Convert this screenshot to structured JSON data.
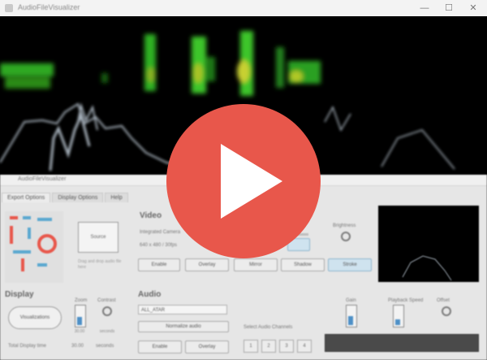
{
  "window": {
    "title": "AudioFileVisualizer",
    "controls": [
      "—",
      "☐",
      "✕"
    ]
  },
  "panel": {
    "title": "AudioFileVisualizer",
    "tabs": [
      "Export Options",
      "Display Options",
      "Help"
    ],
    "active_tab": 0,
    "preview": {
      "label": "Source",
      "hint": "Drag and drop audio file here"
    },
    "video": {
      "heading": "Video",
      "integrated_label": "Integrated Camera",
      "resolution": "640 x 480 / 30fps",
      "buttons": [
        "Enable",
        "Overlay",
        "Mirror",
        "Shadow",
        "Stroke"
      ],
      "active_buttons": [
        false,
        false,
        false,
        false,
        true
      ],
      "knob_label": "Brightness",
      "slider_fill": 0.7
    },
    "display": {
      "heading": "Display",
      "pill_label": "Visualizations",
      "knob1_label": "Zoom",
      "knob2_label": "Contrast",
      "zoom_value": "30.00",
      "contrast_value": "seconds",
      "total_label": "Total Display time",
      "total_value": "30.00",
      "total_unit": "seconds"
    },
    "audio": {
      "heading": "Audio",
      "source_select": "ALL_ATAR",
      "normalize_btn": "Normalize audio",
      "buttons": [
        "Enable",
        "Overlay"
      ],
      "channels_label": "Select Audio Channels",
      "channels": [
        "1",
        "2",
        "3",
        "4"
      ],
      "gain_label": "Gain",
      "speed_label": "Playback Speed",
      "offset_label": "Offset",
      "gain_level": 0.5,
      "speed_level": 0.3
    }
  },
  "overlay": {
    "icon": "play-icon"
  },
  "colors": {
    "overlay": "#e8574b",
    "spectrum": "#33cc22",
    "accent": "#4d8fc6"
  }
}
